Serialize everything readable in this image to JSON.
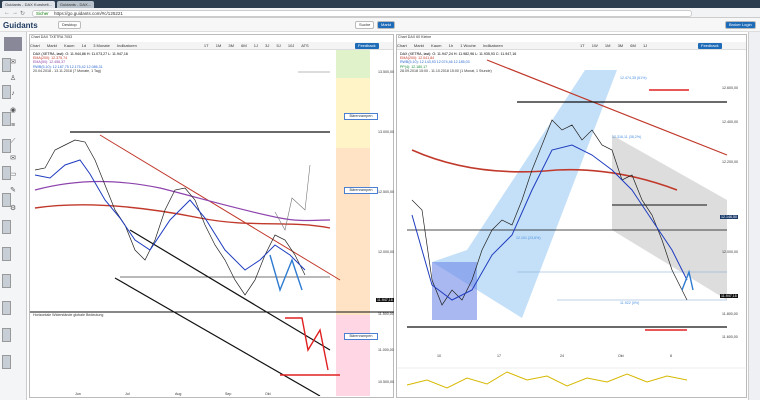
{
  "browser": {
    "tabs": [
      "Guidants - DAX Kurshelt...",
      "Guidants - DAX..."
    ],
    "url_prefix": "Sicher",
    "url": "https://go.guidants.com/#c/125221"
  },
  "app": {
    "logo": "Guidants",
    "desktop_label": "Desktop",
    "search_label": "Suche",
    "market_label": "Markt",
    "broker_label": "Broker Login"
  },
  "left_panel": {
    "title": "Chart DAX TXETRA 7053",
    "toolbar": [
      "Chart",
      "Markt",
      "Kaum",
      "1d",
      "3 Monate",
      "Indikatoren"
    ],
    "periods": [
      "1T",
      "1M",
      "3M",
      "6M",
      "1J",
      "3J",
      "5J",
      "10J",
      "ATS"
    ],
    "feedback": "Feedback",
    "legend": [
      "DAX (XETRA, last): O: 11.944,86 H: 11.073,27 L: 11.947,16",
      "EMA(200): 12.375,74",
      "EMA(50): 12.456,37",
      "RWB(5,10): 12.187,75 12.175,42 12.086,31",
      "20.04.2018 - 13.11.2018 (7 Monate, 1 Tag)"
    ],
    "zones": [
      "Bärenrampen",
      "Bärenrampen",
      "Bärenrampen"
    ],
    "bottom_note": "Horizontale Widerstände globale Bedeutung",
    "price_labels": [
      "13.500,00",
      "13.000,00",
      "12.500,00",
      "12.000,00",
      "11.947,16",
      "11.500,00",
      "11.000,00",
      "10.500,00"
    ],
    "x_labels": [
      "Jun",
      "Jul",
      "Aug",
      "Sep",
      "Okt"
    ]
  },
  "right_panel": {
    "title": "Chart DAX 60 Kleine",
    "toolbar": [
      "Chart",
      "Markt",
      "Kaum",
      "1h",
      "1 Woche",
      "Indikatoren"
    ],
    "periods": [
      "1T",
      "1W",
      "1M",
      "3M",
      "6M",
      "1J"
    ],
    "feedback": "Feedback",
    "legend": [
      "DAX (XETRA, last): O: 11.947,24 H: 11.982,96 L: 11.935,93 C: 11.947,16",
      "EMA(200): 12.041,84",
      "RWB(5,10): 12.143,93 12.074,46 12.185,03",
      "PP(4): 12.180,17",
      "28.09.2018 15:00 - 11.10.2018 15:00 (1 Monat, 1 Stunde)"
    ],
    "price_labels": [
      "12.600,00",
      "12.400,00",
      "12.200,00",
      "12.146,50",
      "12.000,00",
      "11.947,16",
      "11.800,00",
      "11.600,00"
    ],
    "x_labels": [
      "10",
      "17",
      "24",
      "Okt",
      "8"
    ],
    "fib_labels": [
      "12.474,35 (61%)",
      "12.316,11 (38,2%)",
      "12.101 (23,6%)",
      "11.922 (0%)"
    ]
  },
  "colors": {
    "accent": "#1e6bb8",
    "red_trend": "#c0392b",
    "purple": "#8e44ad",
    "fib_blue": "#4a8fe0"
  }
}
